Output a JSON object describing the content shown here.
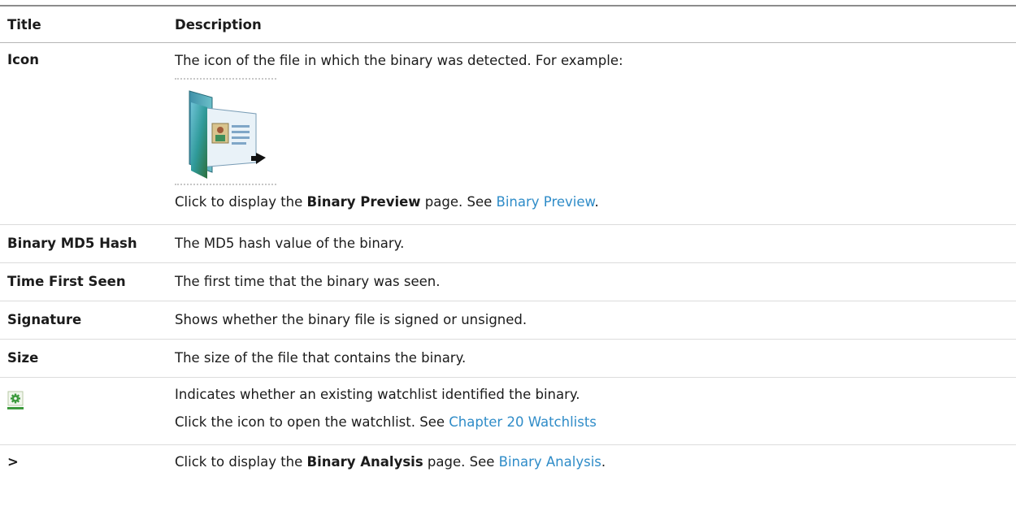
{
  "table": {
    "header": {
      "title": "Title",
      "description": "Description"
    },
    "icon_row": {
      "title": "Icon",
      "desc_line1": "The icon of the file in which the binary was detected. For example:",
      "desc2_prefix": "Click to display the ",
      "desc2_bold": "Binary Preview",
      "desc2_middle": " page. See ",
      "desc2_link": "Binary Preview",
      "desc2_suffix": ".",
      "example_icon": "binary-file-icon"
    },
    "rows": [
      {
        "title": "Binary MD5 Hash",
        "description": "The MD5 hash value of the binary."
      },
      {
        "title": "Time First Seen",
        "description": "The first time that the binary was seen."
      },
      {
        "title": "Signature",
        "description": "Shows whether the binary file is signed or unsigned."
      },
      {
        "title": "Size",
        "description": "The size of the file that contains the binary."
      }
    ],
    "watchlist_row": {
      "title_icon": "watchlist-gear-icon",
      "desc_line1": "Indicates whether an existing watchlist identified the binary.",
      "desc2_prefix": "Click the icon to open the watchlist. See ",
      "desc2_link": "Chapter 20 Watchlists"
    },
    "analysis_row": {
      "title": ">",
      "desc_prefix": "Click to display the ",
      "desc_bold": "Binary Analysis",
      "desc_middle": " page. See ",
      "desc_link": "Binary Analysis",
      "desc_suffix": "."
    }
  },
  "colors": {
    "link": "#2f8cc8",
    "text": "#1b1b1b",
    "rule": "#dcdcdc",
    "watchlist_green": "#3c9a3c"
  }
}
